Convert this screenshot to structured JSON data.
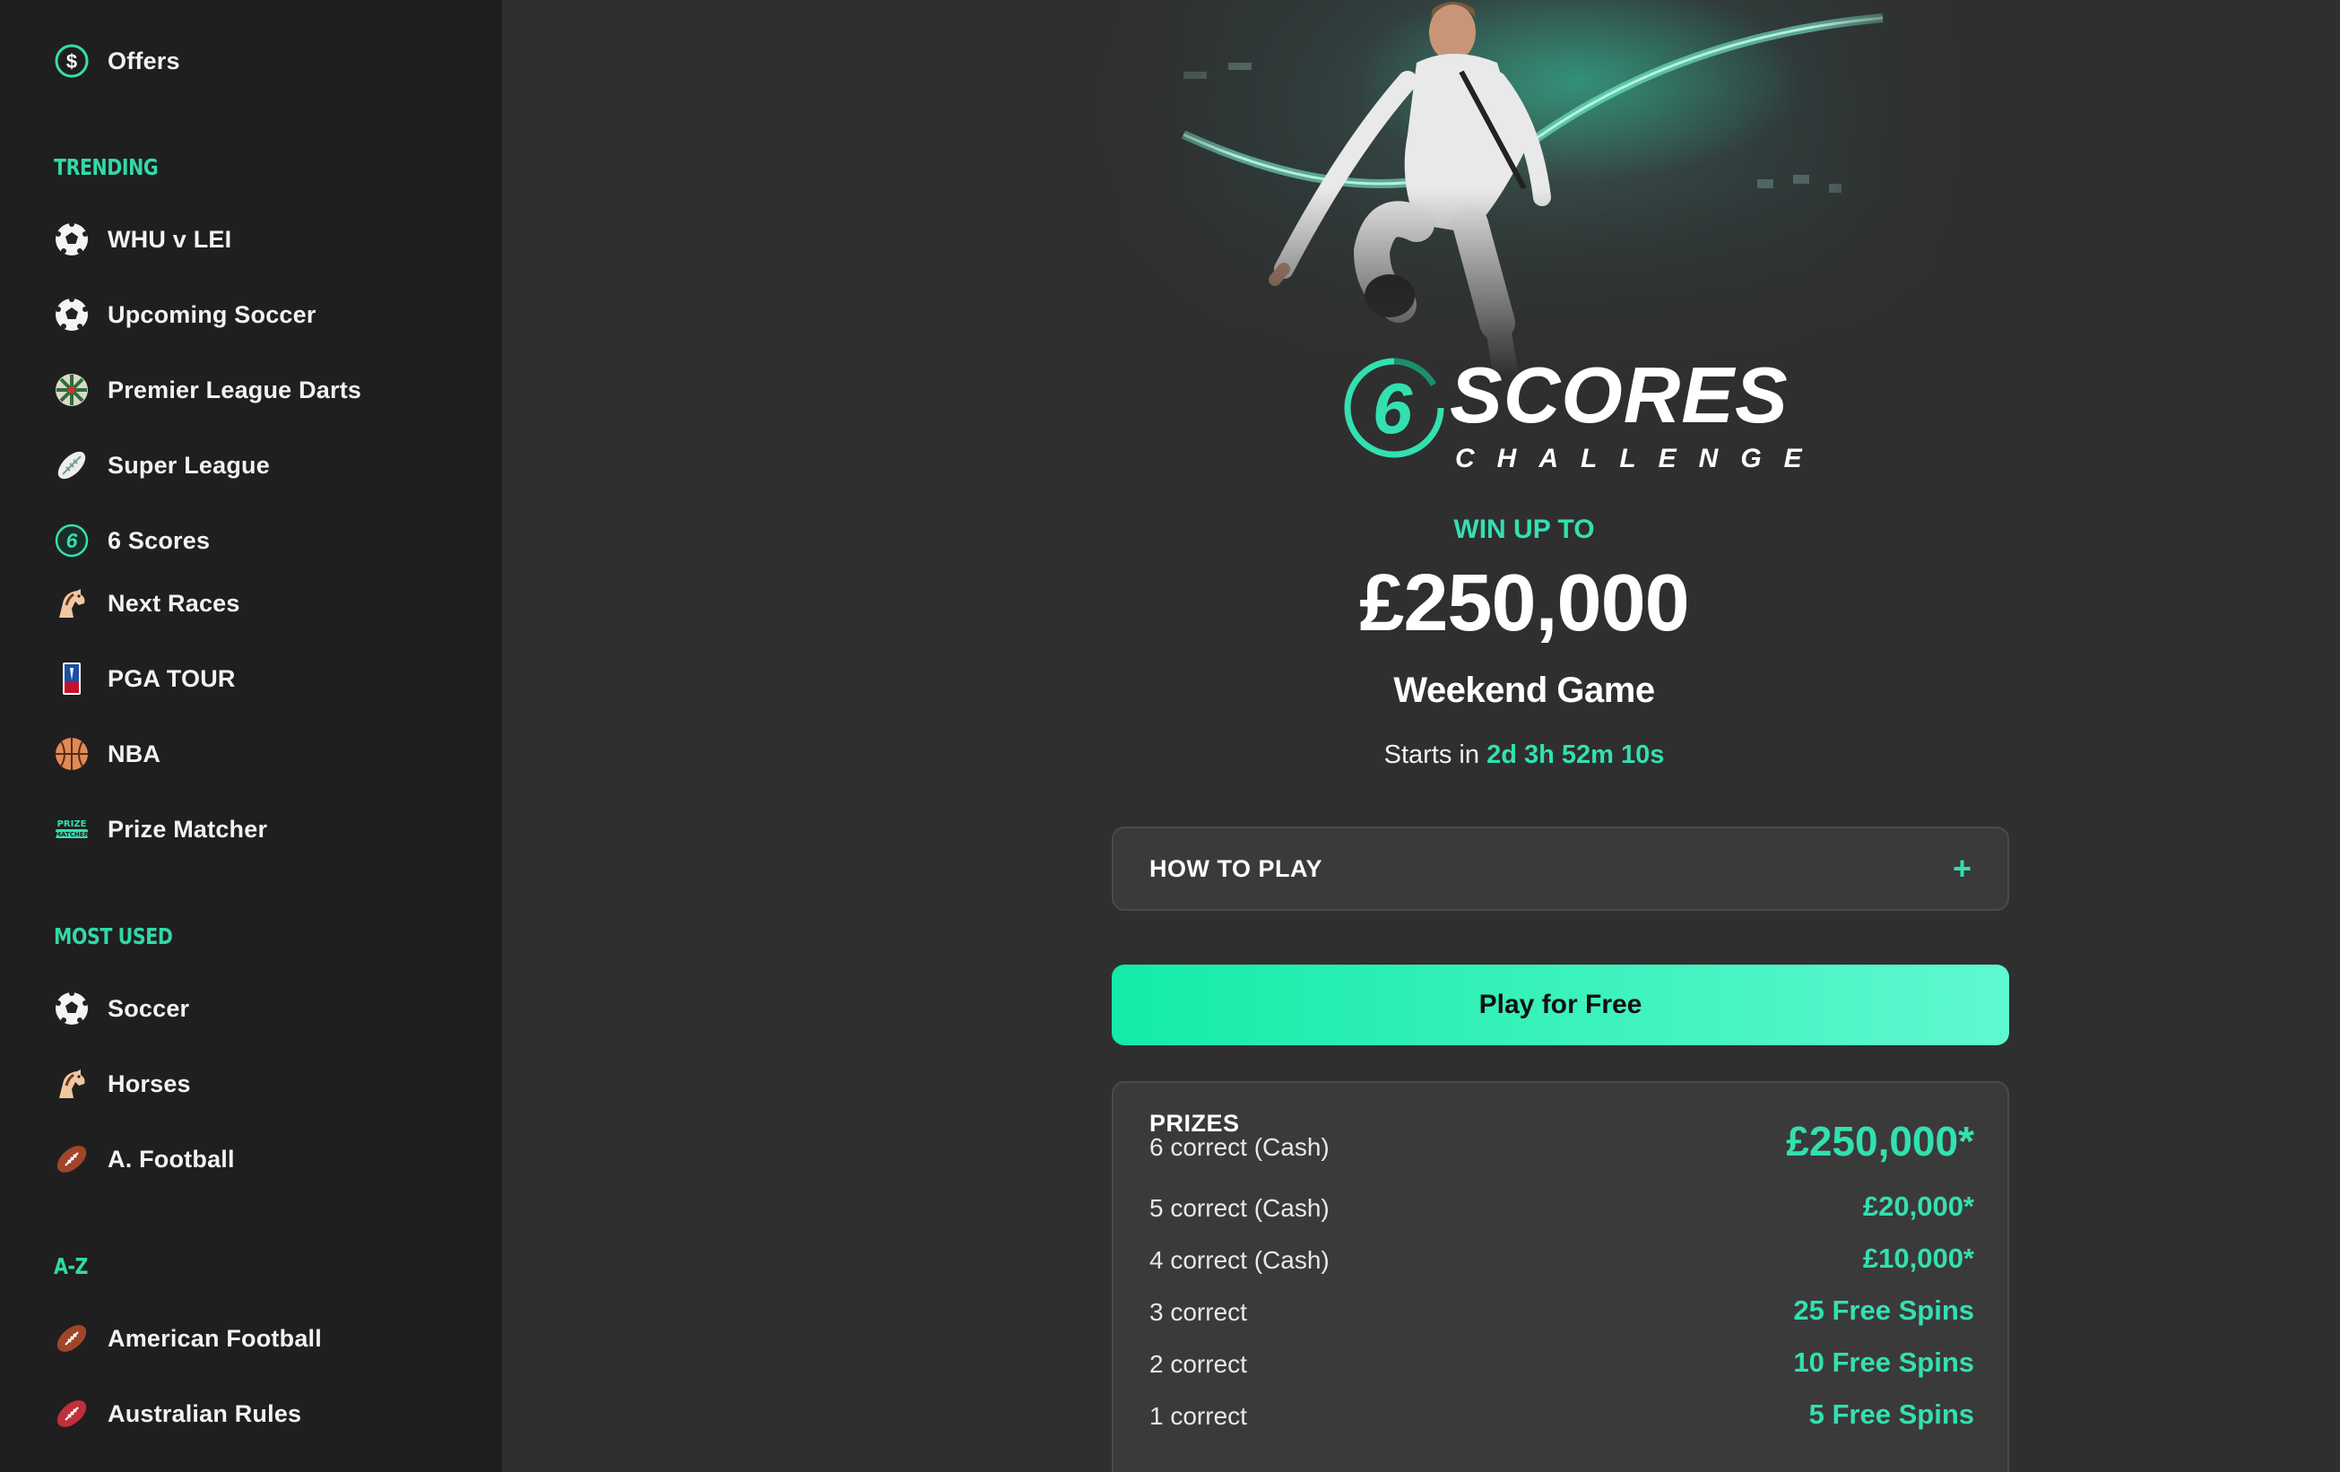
{
  "sidebar": {
    "top_item": {
      "label": "Offers",
      "icon": "dollar-circle-icon"
    },
    "sections": [
      {
        "heading": "TRENDING",
        "items": [
          {
            "label": "WHU v LEI",
            "icon": "soccer-ball-icon"
          },
          {
            "label": "Upcoming Soccer",
            "icon": "soccer-ball-icon"
          },
          {
            "label": "Premier League Darts",
            "icon": "dartboard-icon"
          },
          {
            "label": "Super League",
            "icon": "rugby-ball-icon"
          },
          {
            "label": "6 Scores",
            "icon": "six-scores-icon"
          },
          {
            "label": "Next Races",
            "icon": "horse-head-icon"
          },
          {
            "label": "PGA TOUR",
            "icon": "pga-tour-icon"
          },
          {
            "label": "NBA",
            "icon": "basketball-icon"
          },
          {
            "label": "Prize Matcher",
            "icon": "prize-matcher-icon"
          }
        ]
      },
      {
        "heading": "MOST USED",
        "items": [
          {
            "label": "Soccer",
            "icon": "soccer-ball-icon"
          },
          {
            "label": "Horses",
            "icon": "horse-head-icon"
          },
          {
            "label": "A. Football",
            "icon": "american-football-icon"
          }
        ]
      },
      {
        "heading": "A-Z",
        "items": [
          {
            "label": "American Football",
            "icon": "american-football-icon"
          },
          {
            "label": "Australian Rules",
            "icon": "aussie-rules-ball-icon"
          }
        ]
      }
    ]
  },
  "main": {
    "logo": {
      "numeral": "6",
      "word": "SCORES",
      "sub": "CHALLENGE"
    },
    "win_up_to": "WIN UP TO",
    "amount": "£250,000",
    "game_name": "Weekend Game",
    "starts_prefix": "Starts in",
    "countdown": "2d 3h 52m 10s",
    "how_to_play": {
      "label": "HOW TO PLAY",
      "toggle": "+"
    },
    "play_button": "Play for Free",
    "prizes": {
      "title": "PRIZES",
      "rows": [
        {
          "label": "6 correct (Cash)",
          "value": "£250,000*"
        },
        {
          "label": "5 correct (Cash)",
          "value": "£20,000*"
        },
        {
          "label": "4 correct (Cash)",
          "value": "£10,000*"
        },
        {
          "label": "3 correct",
          "value": "25 Free Spins"
        },
        {
          "label": "2 correct",
          "value": "10 Free Spins"
        },
        {
          "label": "1 correct",
          "value": "5 Free Spins"
        }
      ]
    }
  },
  "colors": {
    "accent": "#33e0b0",
    "sidebar_bg": "#1f1f1f",
    "main_bg": "#2f2f2f",
    "card_bg": "#3a3a3a"
  }
}
